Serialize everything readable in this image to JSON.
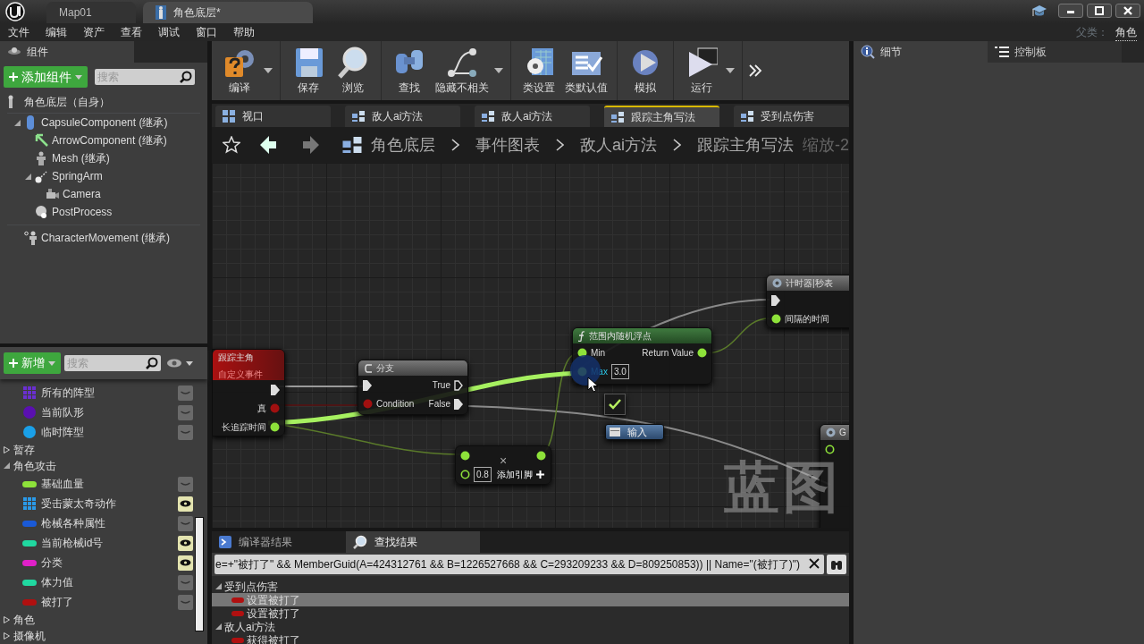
{
  "title_bar": {
    "tabs": [
      {
        "label": "Map01",
        "selected": false
      },
      {
        "label": "角色底层*",
        "selected": true
      }
    ]
  },
  "menu": [
    "文件",
    "编辑",
    "资产",
    "查看",
    "调试",
    "窗口",
    "帮助"
  ],
  "parent_class": {
    "label": "父类：",
    "value": "角色"
  },
  "components": {
    "tab": "组件",
    "add_button": "添加组件",
    "search": {
      "placeholder": "搜索"
    },
    "root": "角色底层（自身）",
    "tree": [
      {
        "label": "CapsuleComponent (继承)",
        "kind": "capsule",
        "expanded": true,
        "children": [
          {
            "label": "ArrowComponent (继承)",
            "kind": "arrow"
          },
          {
            "label": "Mesh (继承)",
            "kind": "mesh"
          },
          {
            "label": "SpringArm",
            "kind": "spring-arm",
            "expanded": true,
            "children": [
              {
                "label": "Camera",
                "kind": "camera"
              }
            ]
          },
          {
            "label": "PostProcess",
            "kind": "sphere"
          }
        ]
      },
      {
        "label": "CharacterMovement (继承)",
        "kind": "movement"
      }
    ]
  },
  "toolbar": [
    {
      "buttons": [
        {
          "label": "编译",
          "kind": "compile",
          "dropdown": true
        }
      ]
    },
    {
      "buttons": [
        {
          "label": "保存",
          "kind": "save",
          "dropdown": false
        },
        {
          "label": "浏览",
          "kind": "browse",
          "dropdown": false
        }
      ]
    },
    {
      "buttons": [
        {
          "label": "查找",
          "kind": "find",
          "dropdown": false
        },
        {
          "label": "隐藏不相关",
          "kind": "hide",
          "dropdown": true
        }
      ]
    },
    {
      "buttons": [
        {
          "label": "类设置",
          "kind": "settings",
          "dropdown": false
        },
        {
          "label": "类默认值",
          "kind": "defaults",
          "dropdown": false
        }
      ]
    },
    {
      "buttons": [
        {
          "label": "模拟",
          "kind": "simulate",
          "dropdown": false
        }
      ]
    },
    {
      "buttons": [
        {
          "label": "运行",
          "kind": "run",
          "dropdown": true
        }
      ]
    }
  ],
  "document_tabs": [
    {
      "label": "视口",
      "kind": "viewport",
      "selected": false
    },
    {
      "label": "敌人ai方法",
      "kind": "graph",
      "selected": false
    },
    {
      "label": "敌人ai方法",
      "kind": "graph",
      "selected": false
    },
    {
      "label": "跟踪主角写法",
      "kind": "graph",
      "selected": true
    },
    {
      "label": "受到点伤害",
      "kind": "graph",
      "selected": false
    }
  ],
  "graph": {
    "breadcrumb": [
      "角色底层",
      "事件图表",
      "敌人ai方法",
      "跟踪主角写法"
    ],
    "zoom": "缩放-2",
    "graph_label": "蓝图",
    "nodes": [
      {
        "kind": "event",
        "title": "跟踪主角",
        "subtitle": "自定义事件",
        "outputs": [
          {
            "kind": "exec",
            "connected": true
          },
          {
            "kind": "bool",
            "label": "真",
            "connected": true
          },
          {
            "kind": "float",
            "label": "长追踪时间",
            "connected": true
          }
        ]
      },
      {
        "kind": "branch",
        "title": "分支",
        "inputs": [
          {
            "kind": "exec",
            "connected": true
          },
          {
            "kind": "bool",
            "label": "Condition",
            "connected": true
          }
        ],
        "outputs": [
          {
            "kind": "exec",
            "label": "True",
            "connected": false
          },
          {
            "kind": "exec",
            "label": "False",
            "connected": true
          }
        ]
      },
      {
        "kind": "function",
        "title": "范围内随机浮点",
        "inputs": [
          {
            "kind": "float",
            "label": "Min",
            "connected": true,
            "hovered": false
          },
          {
            "kind": "float",
            "label": "Max",
            "connected": true,
            "hovered": true,
            "value": "3.0"
          }
        ],
        "outputs": [
          {
            "kind": "float",
            "label": "Return Value",
            "connected": true
          }
        ]
      },
      {
        "kind": "timer",
        "title": "计时器|秒表",
        "inputs": [
          {
            "kind": "exec",
            "connected": true
          },
          {
            "kind": "float",
            "label": "间隔的时间",
            "connected": true
          }
        ]
      },
      {
        "kind": "math",
        "title": "×",
        "add_pin": "添加引脚",
        "inputs": [
          {
            "kind": "float",
            "connected": true
          },
          {
            "kind": "float",
            "connected": false,
            "value": "0.8"
          }
        ],
        "outputs": [
          {
            "kind": "float",
            "connected": true
          }
        ]
      },
      {
        "kind": "checkbox",
        "checked": true
      },
      {
        "kind": "button",
        "label": "输入"
      },
      {
        "kind": "timer",
        "title": "G",
        "inputs": [
          {
            "kind": "float",
            "connected": false
          }
        ]
      }
    ]
  },
  "my_blueprint": {
    "add_button": "新增",
    "search": {
      "placeholder": "搜索"
    },
    "items": [
      {
        "kind": "grid",
        "label": "所有的阵型",
        "color": "#6a2fd0",
        "visible": false
      },
      {
        "kind": "sphere",
        "label": "当前队形",
        "color": "#5a10b0",
        "visible": false
      },
      {
        "kind": "sphere",
        "label": "临时阵型",
        "color": "#1aa0e8",
        "visible": false
      },
      {
        "kind": "category",
        "label": "暂存",
        "expanded": false
      },
      {
        "kind": "category",
        "label": "角色攻击",
        "expanded": true,
        "children": [
          {
            "kind": "pill",
            "label": "基础血量",
            "color": "#8ee23a",
            "visible": false
          },
          {
            "kind": "grid",
            "label": "受击蒙太奇动作",
            "color": "#2a9ae8",
            "visible": true
          },
          {
            "kind": "pill",
            "label": "枪械各种属性",
            "color": "#1a5ad8",
            "visible": false
          },
          {
            "kind": "pill",
            "label": "当前枪械id号",
            "color": "#20d8a0",
            "visible": true
          },
          {
            "kind": "pill",
            "label": "分类",
            "color": "#e020c8",
            "visible": true
          },
          {
            "kind": "pill",
            "label": "体力值",
            "color": "#20d8a0",
            "visible": false
          },
          {
            "kind": "pill",
            "label": "被打了",
            "color": "#b01010",
            "visible": false
          }
        ]
      },
      {
        "kind": "category",
        "label": "角色",
        "expanded": false
      },
      {
        "kind": "category",
        "label": "摄像机",
        "expanded": false
      }
    ]
  },
  "bottom_panel": {
    "tabs": [
      {
        "label": "编译器结果",
        "kind": "compiler",
        "selected": false
      },
      {
        "label": "查找结果",
        "kind": "find",
        "selected": true
      }
    ],
    "search": {
      "value": "e=+\"被打了\" && MemberGuid(A=424312761 && B=1226527668 && C=293209233 && D=809250853)) || Name=\"(被打了)\")"
    },
    "results": [
      {
        "label": "受到点伤害",
        "expanded": true,
        "children": [
          {
            "label": "设置被打了",
            "selected": true
          },
          {
            "label": "设置被打了",
            "selected": false
          }
        ]
      },
      {
        "label": "敌人ai方法",
        "expanded": true,
        "children": [
          {
            "label": "获得被打了",
            "selected": false
          }
        ]
      }
    ]
  },
  "details_tabs": [
    {
      "label": "细节",
      "kind": "details",
      "selected": true
    },
    {
      "label": "控制板",
      "kind": "palette",
      "selected": false
    }
  ]
}
